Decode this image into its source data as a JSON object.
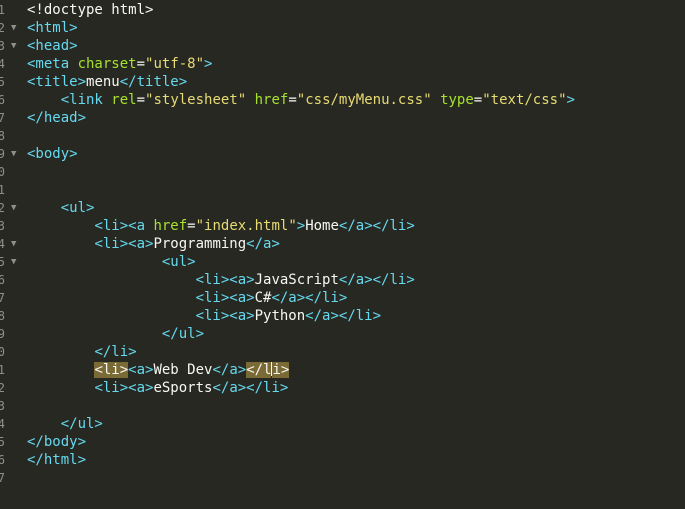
{
  "colors": {
    "background": "#272822",
    "tag": "#66d9ef",
    "attribute": "#a6e22e",
    "string": "#e6db74",
    "text": "#f8f8f2",
    "gutter": "#8f908a",
    "bracket_highlight": "#7a6a35"
  },
  "icons": {
    "fold_marker": "▼"
  },
  "lines": [
    {
      "num": "1",
      "fold": false,
      "tokens": [
        {
          "t": "<!doctype html>",
          "c": "text"
        }
      ]
    },
    {
      "num": "2",
      "fold": true,
      "tokens": [
        {
          "t": "<html>",
          "c": "tag"
        }
      ]
    },
    {
      "num": "3",
      "fold": true,
      "tokens": [
        {
          "t": "<head>",
          "c": "tag"
        }
      ]
    },
    {
      "num": "4",
      "fold": false,
      "tokens": [
        {
          "t": "<meta ",
          "c": "tag"
        },
        {
          "t": "charset",
          "c": "attr"
        },
        {
          "t": "=",
          "c": "text"
        },
        {
          "t": "\"utf-8\"",
          "c": "str"
        },
        {
          "t": ">",
          "c": "tag"
        }
      ]
    },
    {
      "num": "5",
      "fold": false,
      "tokens": [
        {
          "t": "<title>",
          "c": "tag"
        },
        {
          "t": "menu",
          "c": "text"
        },
        {
          "t": "</title>",
          "c": "tag"
        }
      ]
    },
    {
      "num": "6",
      "fold": false,
      "tokens": [
        {
          "t": "    ",
          "c": "text"
        },
        {
          "t": "<link ",
          "c": "tag"
        },
        {
          "t": "rel",
          "c": "attr"
        },
        {
          "t": "=",
          "c": "text"
        },
        {
          "t": "\"stylesheet\"",
          "c": "str"
        },
        {
          "t": " ",
          "c": "text"
        },
        {
          "t": "href",
          "c": "attr"
        },
        {
          "t": "=",
          "c": "text"
        },
        {
          "t": "\"css/myMenu.css\"",
          "c": "str"
        },
        {
          "t": " ",
          "c": "text"
        },
        {
          "t": "type",
          "c": "attr"
        },
        {
          "t": "=",
          "c": "text"
        },
        {
          "t": "\"text/css\"",
          "c": "str"
        },
        {
          "t": ">",
          "c": "tag"
        }
      ]
    },
    {
      "num": "7",
      "fold": false,
      "tokens": [
        {
          "t": "</head>",
          "c": "tag"
        }
      ]
    },
    {
      "num": "8",
      "fold": false,
      "tokens": []
    },
    {
      "num": "9",
      "fold": true,
      "tokens": [
        {
          "t": "<body>",
          "c": "tag"
        }
      ]
    },
    {
      "num": "0",
      "fold": false,
      "tokens": []
    },
    {
      "num": "1",
      "fold": false,
      "tokens": []
    },
    {
      "num": "2",
      "fold": true,
      "tokens": [
        {
          "t": "    ",
          "c": "text"
        },
        {
          "t": "<ul>",
          "c": "tag"
        }
      ]
    },
    {
      "num": "3",
      "fold": false,
      "tokens": [
        {
          "t": "        ",
          "c": "text"
        },
        {
          "t": "<li><a ",
          "c": "tag"
        },
        {
          "t": "href",
          "c": "attr"
        },
        {
          "t": "=",
          "c": "text"
        },
        {
          "t": "\"index.html\"",
          "c": "str"
        },
        {
          "t": ">",
          "c": "tag"
        },
        {
          "t": "Home",
          "c": "text"
        },
        {
          "t": "</a></li>",
          "c": "tag"
        }
      ]
    },
    {
      "num": "4",
      "fold": true,
      "tokens": [
        {
          "t": "        ",
          "c": "text"
        },
        {
          "t": "<li><a>",
          "c": "tag"
        },
        {
          "t": "Programming",
          "c": "text"
        },
        {
          "t": "</a>",
          "c": "tag"
        }
      ]
    },
    {
      "num": "5",
      "fold": true,
      "tokens": [
        {
          "t": "                ",
          "c": "text"
        },
        {
          "t": "<ul>",
          "c": "tag"
        }
      ]
    },
    {
      "num": "6",
      "fold": false,
      "tokens": [
        {
          "t": "                    ",
          "c": "text"
        },
        {
          "t": "<li><a>",
          "c": "tag"
        },
        {
          "t": "JavaScript",
          "c": "text"
        },
        {
          "t": "</a></li>",
          "c": "tag"
        }
      ]
    },
    {
      "num": "7",
      "fold": false,
      "tokens": [
        {
          "t": "                    ",
          "c": "text"
        },
        {
          "t": "<li><a>",
          "c": "tag"
        },
        {
          "t": "C#",
          "c": "text"
        },
        {
          "t": "</a></li>",
          "c": "tag"
        }
      ]
    },
    {
      "num": "8",
      "fold": false,
      "tokens": [
        {
          "t": "                    ",
          "c": "text"
        },
        {
          "t": "<li><a>",
          "c": "tag"
        },
        {
          "t": "Python",
          "c": "text"
        },
        {
          "t": "</a></li>",
          "c": "tag"
        }
      ]
    },
    {
      "num": "9",
      "fold": false,
      "tokens": [
        {
          "t": "                ",
          "c": "text"
        },
        {
          "t": "</ul>",
          "c": "tag"
        }
      ]
    },
    {
      "num": "0",
      "fold": false,
      "tokens": [
        {
          "t": "        ",
          "c": "text"
        },
        {
          "t": "</li>",
          "c": "tag"
        }
      ]
    },
    {
      "num": "1",
      "fold": false,
      "tokens": [
        {
          "t": "        ",
          "c": "text"
        },
        {
          "t": "<li>",
          "c": "hl"
        },
        {
          "t": "<a>",
          "c": "tag"
        },
        {
          "t": "Web Dev",
          "c": "text"
        },
        {
          "t": "</a>",
          "c": "tag"
        },
        {
          "t": "</l",
          "c": "hl"
        },
        {
          "t": "CURSOR",
          "c": "cursor"
        },
        {
          "t": "i>",
          "c": "hl"
        }
      ]
    },
    {
      "num": "2",
      "fold": false,
      "tokens": [
        {
          "t": "        ",
          "c": "text"
        },
        {
          "t": "<li><a>",
          "c": "tag"
        },
        {
          "t": "eSports",
          "c": "text"
        },
        {
          "t": "</a></li>",
          "c": "tag"
        }
      ]
    },
    {
      "num": "3",
      "fold": false,
      "tokens": []
    },
    {
      "num": "4",
      "fold": false,
      "tokens": [
        {
          "t": "    ",
          "c": "text"
        },
        {
          "t": "</ul>",
          "c": "tag"
        }
      ]
    },
    {
      "num": "5",
      "fold": false,
      "tokens": [
        {
          "t": "</body>",
          "c": "tag"
        }
      ]
    },
    {
      "num": "6",
      "fold": false,
      "tokens": [
        {
          "t": "</html>",
          "c": "tag"
        }
      ]
    },
    {
      "num": "7",
      "fold": false,
      "tokens": []
    }
  ]
}
